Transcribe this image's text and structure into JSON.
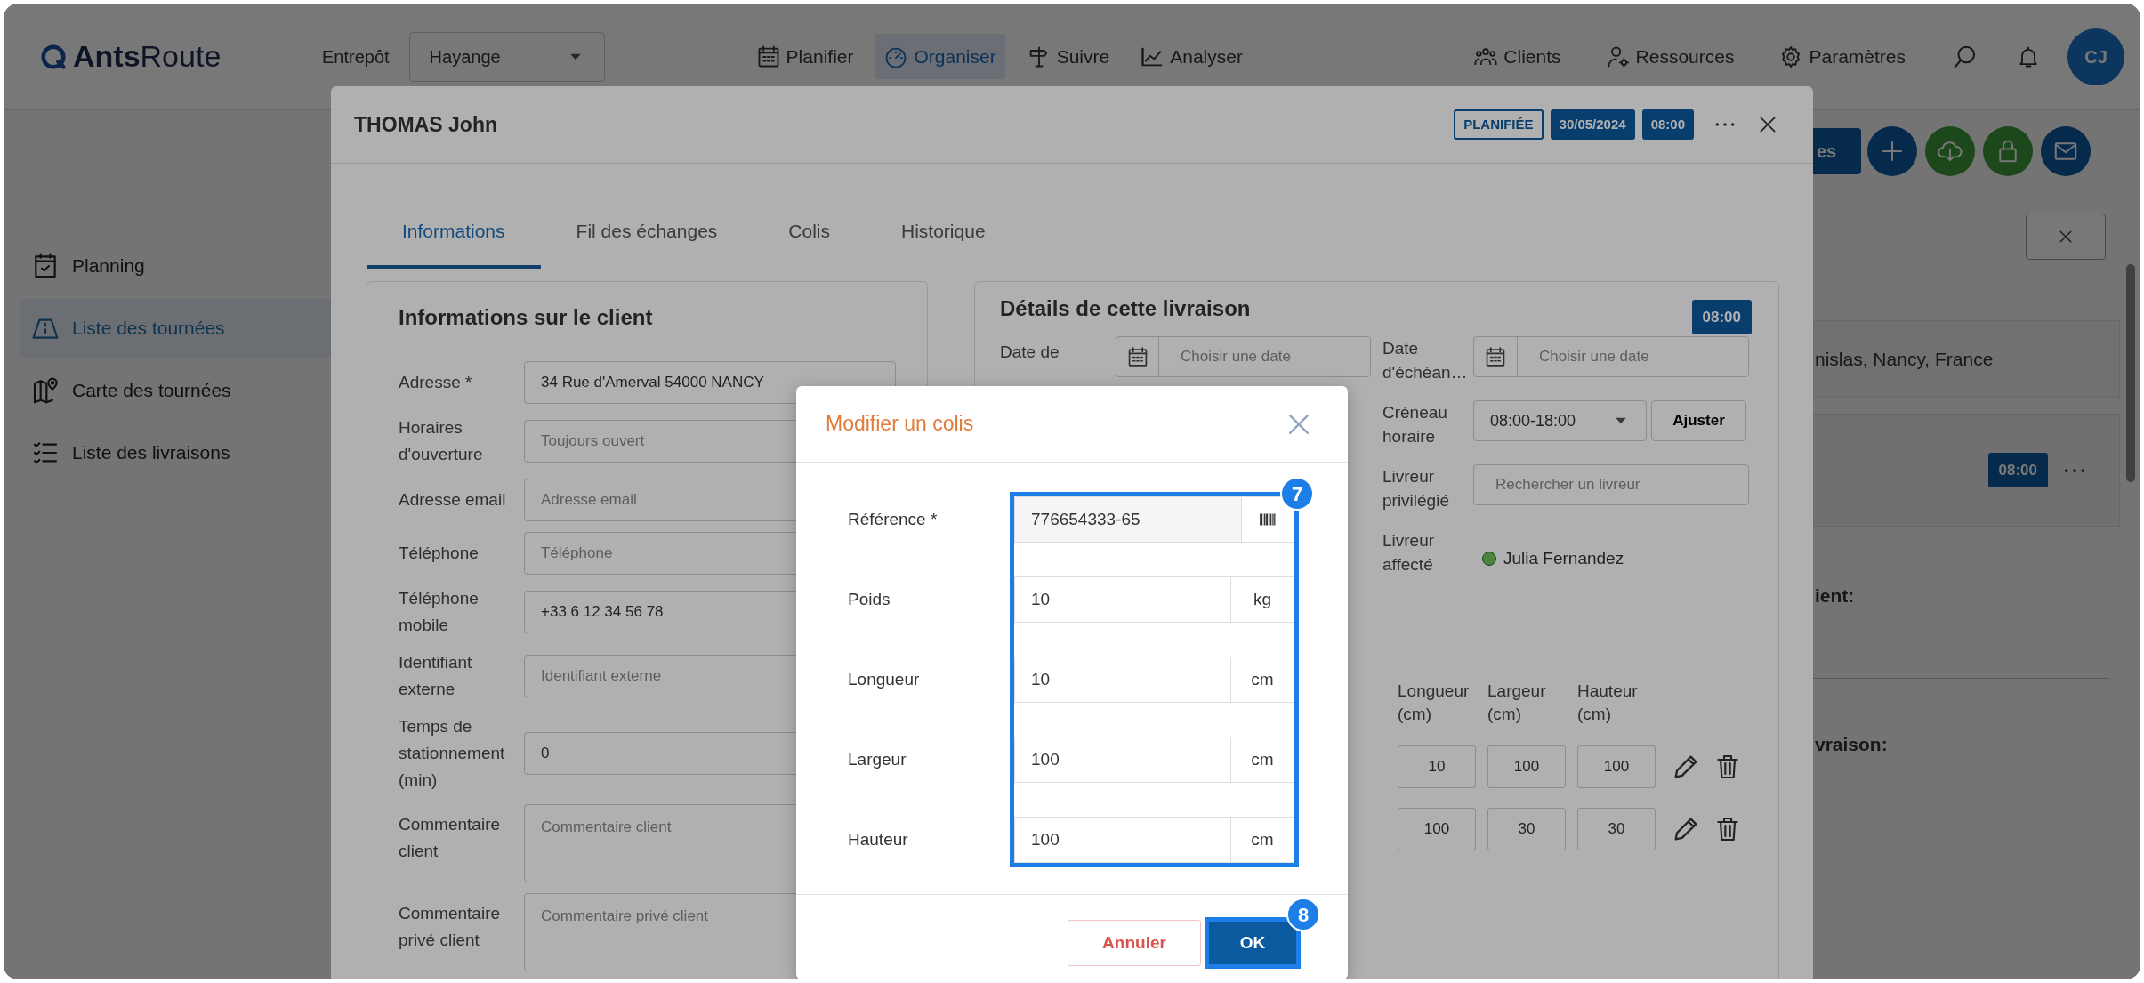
{
  "navbar": {
    "logo": "**Ants**Route",
    "warehouse_label": "Entrepôt",
    "warehouse": "Hayange",
    "menu": [
      {
        "label": "Planifier",
        "selected": false
      },
      {
        "label": "Organiser",
        "selected": true
      },
      {
        "label": "Suivre",
        "selected": false
      },
      {
        "label": "Analyser",
        "selected": false
      }
    ],
    "right_menu": [
      {
        "label": "Clients"
      },
      {
        "label": "Ressources"
      },
      {
        "label": "Paramètres"
      }
    ],
    "avatar": "CJ"
  },
  "sidebar": {
    "items": [
      {
        "label": "Planning",
        "selected": false
      },
      {
        "label": "Liste des tournées",
        "selected": true
      },
      {
        "label": "Carte des tournées",
        "selected": false
      },
      {
        "label": "Liste des livraisons",
        "selected": false
      }
    ]
  },
  "background": {
    "button_fragment": "es",
    "address_fragment": "nislas, Nancy, France",
    "time_badge": "08:00",
    "heading_fragments": [
      "ient:",
      "vraison:"
    ]
  },
  "modal": {
    "title": "THOMAS John",
    "status": "PLANIFIÉE",
    "date": "30/05/2024",
    "time": "08:00",
    "tabs": [
      {
        "label": "Informations",
        "selected": true
      },
      {
        "label": "Fil des échanges",
        "selected": false
      },
      {
        "label": "Colis",
        "selected": false
      },
      {
        "label": "Historique",
        "selected": false
      }
    ],
    "client_card": {
      "title": "Informations sur le client",
      "fields": [
        {
          "kind": "input",
          "label": "Adresse *",
          "value": "34 Rue d'Amerval 54000 NANCY"
        },
        {
          "kind": "input",
          "label": "Horaires d'ouverture",
          "placeholder": "Toujours ouvert"
        },
        {
          "kind": "input",
          "label": "Adresse email",
          "placeholder": "Adresse email"
        },
        {
          "kind": "input",
          "label": "Téléphone",
          "placeholder": "Téléphone"
        },
        {
          "kind": "input",
          "label": "Téléphone mobile",
          "value": "+33 6 12 34 56 78"
        },
        {
          "kind": "input",
          "label": "Identifiant externe",
          "placeholder": "Identifiant externe"
        },
        {
          "kind": "input",
          "label": "Temps de stationnement (min)",
          "value": "0"
        },
        {
          "kind": "textarea",
          "label": "Commentaire client",
          "placeholder": "Commentaire client"
        },
        {
          "kind": "textarea",
          "label": "Commentaire privé client",
          "placeholder": "Commentaire privé client"
        }
      ]
    },
    "delivery_card": {
      "title": "Détails de cette livraison",
      "time": "08:00",
      "date_field": {
        "label": "Date de",
        "placeholder": "Choisir une date"
      },
      "fields": [
        {
          "kind": "date",
          "label": "Date d'échéan…",
          "placeholder": "Choisir une date"
        },
        {
          "kind": "select",
          "label": "Créneau horaire",
          "value": "08:00-18:00",
          "button": "Ajuster"
        },
        {
          "kind": "search",
          "label": "Livreur privilégié",
          "placeholder": "Rechercher un livreur"
        },
        {
          "kind": "driver",
          "label": "Livreur affecté",
          "value": "Julia Fernandez"
        }
      ],
      "packages": {
        "columns": [
          "Longueur (cm)",
          "Largeur (cm)",
          "Hauteur (cm)"
        ],
        "rows": [
          [
            "10",
            "100",
            "100"
          ],
          [
            "100",
            "30",
            "30"
          ]
        ]
      }
    }
  },
  "dialog": {
    "title": "Modifier un colis",
    "fields": [
      {
        "kind": "barcode",
        "label": "Référence *",
        "value": "776654333-65"
      },
      {
        "kind": "unit",
        "label": "Poids",
        "value": "10",
        "unit": "kg"
      },
      {
        "kind": "unit",
        "label": "Longueur",
        "value": "10",
        "unit": "cm"
      },
      {
        "kind": "unit",
        "label": "Largeur",
        "value": "100",
        "unit": "cm"
      },
      {
        "kind": "unit",
        "label": "Hauteur",
        "value": "100",
        "unit": "cm"
      }
    ],
    "fields_callout": "7",
    "cancel": "Annuler",
    "ok": "OK",
    "ok_callout": "8"
  }
}
